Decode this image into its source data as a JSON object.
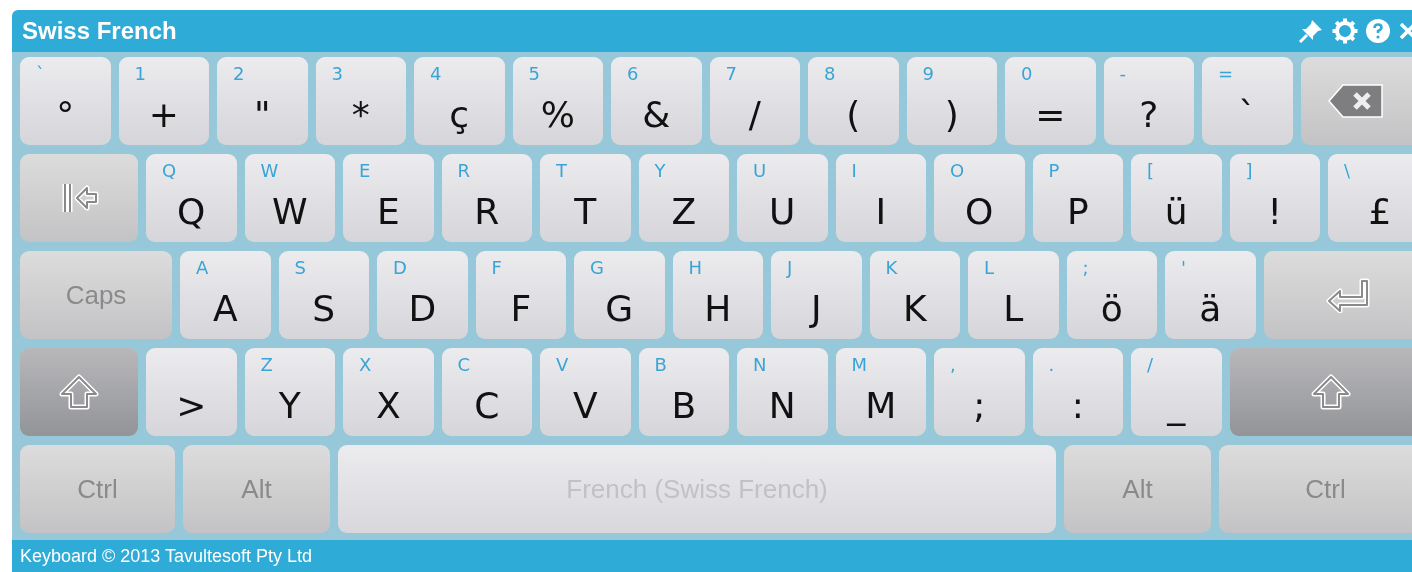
{
  "window": {
    "title": "Swiss French"
  },
  "rows": [
    [
      {
        "kind": "char",
        "hint": "`",
        "label": "°"
      },
      {
        "kind": "char",
        "hint": "1",
        "label": "+"
      },
      {
        "kind": "char",
        "hint": "2",
        "label": "\""
      },
      {
        "kind": "char",
        "hint": "3",
        "label": "*"
      },
      {
        "kind": "char",
        "hint": "4",
        "label": "ç"
      },
      {
        "kind": "char",
        "hint": "5",
        "label": "%"
      },
      {
        "kind": "char",
        "hint": "6",
        "label": "&"
      },
      {
        "kind": "char",
        "hint": "7",
        "label": "/"
      },
      {
        "kind": "char",
        "hint": "8",
        "label": "("
      },
      {
        "kind": "char",
        "hint": "9",
        "label": ")"
      },
      {
        "kind": "char",
        "hint": "0",
        "label": "="
      },
      {
        "kind": "char",
        "hint": "-",
        "label": "?"
      },
      {
        "kind": "char",
        "hint": "=",
        "label": "`"
      },
      {
        "kind": "backspace"
      }
    ],
    [
      {
        "kind": "tab"
      },
      {
        "kind": "char",
        "hint": "Q",
        "label": "Q"
      },
      {
        "kind": "char",
        "hint": "W",
        "label": "W"
      },
      {
        "kind": "char",
        "hint": "E",
        "label": "E"
      },
      {
        "kind": "char",
        "hint": "R",
        "label": "R"
      },
      {
        "kind": "char",
        "hint": "T",
        "label": "T"
      },
      {
        "kind": "char",
        "hint": "Y",
        "label": "Z"
      },
      {
        "kind": "char",
        "hint": "U",
        "label": "U"
      },
      {
        "kind": "char",
        "hint": "I",
        "label": "I"
      },
      {
        "kind": "char",
        "hint": "O",
        "label": "O"
      },
      {
        "kind": "char",
        "hint": "P",
        "label": "P"
      },
      {
        "kind": "char",
        "hint": "[",
        "label": "ü"
      },
      {
        "kind": "char",
        "hint": "]",
        "label": "!"
      },
      {
        "kind": "char",
        "hint": "\\",
        "label": "£"
      }
    ],
    [
      {
        "kind": "caps",
        "label": "Caps"
      },
      {
        "kind": "char",
        "hint": "A",
        "label": "A"
      },
      {
        "kind": "char",
        "hint": "S",
        "label": "S"
      },
      {
        "kind": "char",
        "hint": "D",
        "label": "D"
      },
      {
        "kind": "char",
        "hint": "F",
        "label": "F"
      },
      {
        "kind": "char",
        "hint": "G",
        "label": "G"
      },
      {
        "kind": "char",
        "hint": "H",
        "label": "H"
      },
      {
        "kind": "char",
        "hint": "J",
        "label": "J"
      },
      {
        "kind": "char",
        "hint": "K",
        "label": "K"
      },
      {
        "kind": "char",
        "hint": "L",
        "label": "L"
      },
      {
        "kind": "char",
        "hint": ";",
        "label": "ö"
      },
      {
        "kind": "char",
        "hint": "'",
        "label": "ä"
      },
      {
        "kind": "enter"
      }
    ],
    [
      {
        "kind": "shift"
      },
      {
        "kind": "char",
        "label": ">"
      },
      {
        "kind": "char",
        "hint": "Z",
        "label": "Y"
      },
      {
        "kind": "char",
        "hint": "X",
        "label": "X"
      },
      {
        "kind": "char",
        "hint": "C",
        "label": "C"
      },
      {
        "kind": "char",
        "hint": "V",
        "label": "V"
      },
      {
        "kind": "char",
        "hint": "B",
        "label": "B"
      },
      {
        "kind": "char",
        "hint": "N",
        "label": "N"
      },
      {
        "kind": "char",
        "hint": "M",
        "label": "M"
      },
      {
        "kind": "char",
        "hint": ",",
        "label": ";"
      },
      {
        "kind": "char",
        "hint": ".",
        "label": ":"
      },
      {
        "kind": "char",
        "hint": "/",
        "label": "_"
      },
      {
        "kind": "shift"
      }
    ],
    [
      {
        "kind": "ctrl",
        "label": "Ctrl"
      },
      {
        "kind": "alt",
        "label": "Alt"
      },
      {
        "kind": "space",
        "label": "French (Swiss French)"
      },
      {
        "kind": "alt",
        "label": "Alt"
      },
      {
        "kind": "ctrl",
        "label": "Ctrl"
      }
    ]
  ],
  "status_bar": "Keyboard © 2013 Tavultesoft Pty Ltd"
}
